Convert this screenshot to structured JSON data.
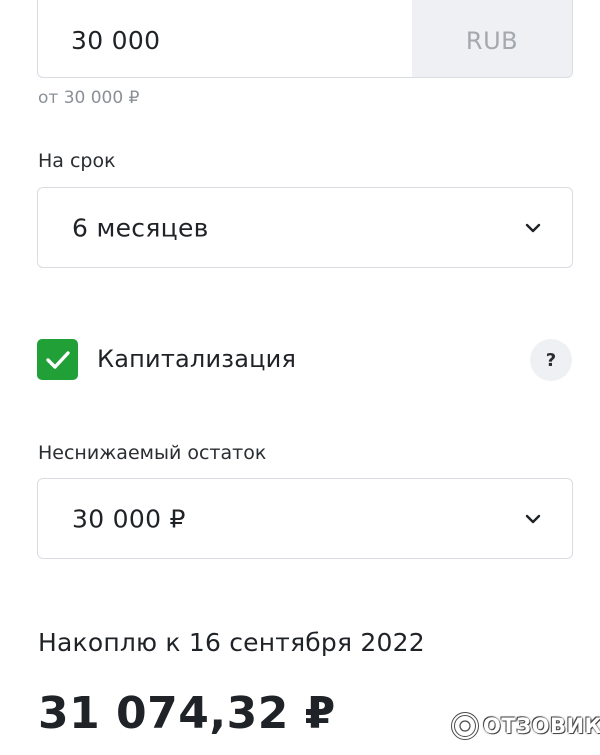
{
  "deposit": {
    "amount_value": "30 000",
    "currency": "RUB",
    "amount_hint": "от 30 000 ₽"
  },
  "term": {
    "label": "На срок",
    "selected": "6 месяцев",
    "icon": "chevron-down-icon"
  },
  "capitalization": {
    "label": "Капитализация",
    "checked": true,
    "help_symbol": "?",
    "accent_color": "#21a038"
  },
  "min_balance": {
    "label": "Неснижаемый остаток",
    "selected": "30 000 ₽",
    "icon": "chevron-down-icon"
  },
  "result": {
    "caption": "Накоплю к 16 сентября 2022",
    "amount": "31 074,32 ₽"
  },
  "watermark": {
    "text": "ОТЗОВИК"
  }
}
